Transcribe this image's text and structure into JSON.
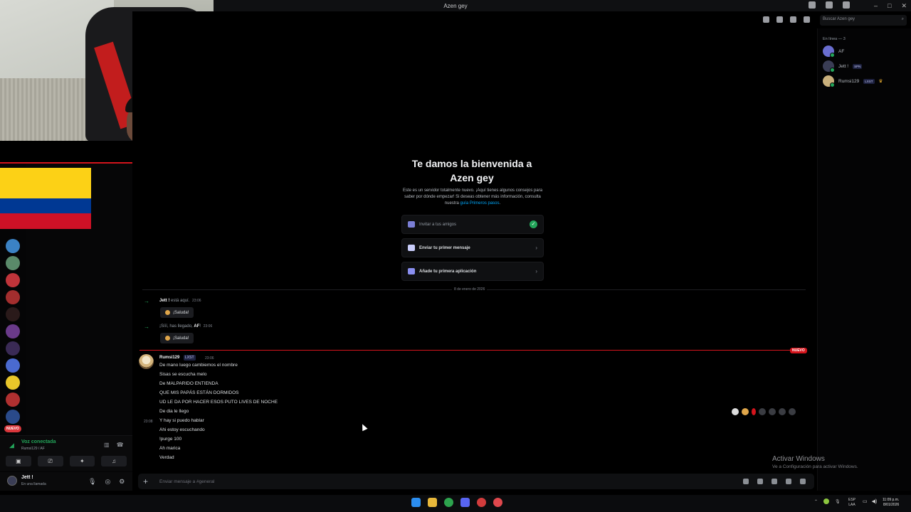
{
  "window": {
    "title": "Azen gey"
  },
  "header": {
    "search_placeholder": "Buscar Azen gey"
  },
  "welcome": {
    "title_line1": "Te damos la bienvenida a",
    "title_line2": "Azen gey",
    "desc": "Este es un servidor totalmente nuevo. ¡Aquí tienes algunos consejos para saber por dónde empezar! Si deseas obtener más información, consulta nuestra ",
    "desc_link": "guía Primeros pasos",
    "desc_end": "."
  },
  "actions": [
    {
      "label": "Invitar a tus amigos",
      "done": true
    },
    {
      "label": "Enviar tu primer mensaje",
      "done": false
    },
    {
      "label": "Añade tu primera aplicación",
      "done": false
    }
  ],
  "date_divider": "8 de enero de 2026",
  "system_messages": [
    {
      "user": "Jett !",
      "text": " está aquí.",
      "time": "23:06",
      "button": "¡Saluda!"
    },
    {
      "prefix": "¡Sííí, has llegado, ",
      "user": "AF",
      "suffix": "!",
      "time": "23:06",
      "button": "¡Saluda!"
    }
  ],
  "new_badge": "NUEVO",
  "message": {
    "author": "Rumsi129",
    "tag": "LXST",
    "time": "23:06",
    "hover_time": "23:08",
    "lines": [
      "De mano luego cambiemos el nombre",
      "Sisas se escucha melo",
      "De MALPARIDO ENTIENDA",
      "QUE MIS PAPÁS ESTÁN DORMIDOS",
      "UD LE DA POR HACER ESOS PUTO LIVES DE NOCHE",
      "De dia le llego",
      "Y hay si puedo hablar",
      "Ahi estoy escuchando",
      "!purge 100",
      "Ah marica",
      "Verdad"
    ]
  },
  "composer": {
    "placeholder": "Enviar mensaje a #general"
  },
  "members": {
    "header": "En línea — 3",
    "list": [
      {
        "name": "AF",
        "badge": ""
      },
      {
        "name": "Jett !",
        "badge": "SPN"
      },
      {
        "name": "Rumsi129",
        "badge": "LXST"
      }
    ]
  },
  "sidebar": {
    "nuevo_pill": "NUEVO"
  },
  "voice": {
    "status": "Voz conectada",
    "sub": "Rumsi129 / AF"
  },
  "user": {
    "name": "Jett !",
    "status": "En una llamada"
  },
  "watermark": {
    "title": "Activar Windows",
    "sub": "Ve a Configuración para activar Windows."
  },
  "tray": {
    "lang1": "ESP",
    "lang2": "LAA",
    "time": "11:09 p.m.",
    "date": "8/01/2026"
  },
  "colors": {
    "accent": "#5865f2",
    "online": "#23a55a",
    "new": "#d4141c",
    "link": "#00a8fc"
  }
}
